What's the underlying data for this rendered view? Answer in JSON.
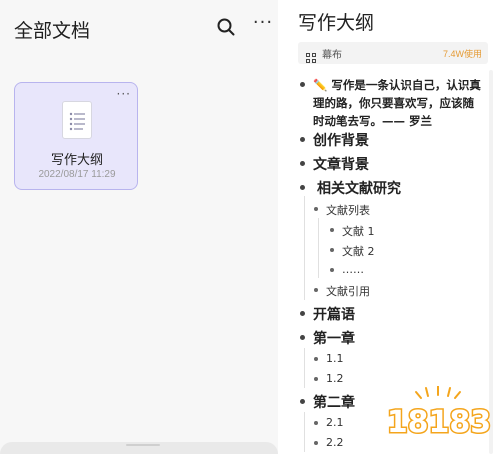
{
  "left": {
    "title": "全部文档",
    "more_glyph": "···",
    "card": {
      "title": "写作大纲",
      "date": "2022/08/17 11:29",
      "more_glyph": "···"
    }
  },
  "right": {
    "title": "写作大纲",
    "app_bar": {
      "name": "幕布",
      "usage": "7.4W使用"
    },
    "intro": "✏️ 写作是一条认识自己，认识真理的路，你只要喜欢写，应该随时动笔去写。—— 罗兰",
    "items": {
      "bg1": "创作背景",
      "bg2": "文章背景",
      "research": "相关文献研究",
      "lit_list": "文献列表",
      "lit1": "文献 1",
      "lit2": "文献 2",
      "lit_more": "……",
      "lit_cite": "文献引用",
      "opening": "开篇语",
      "ch1": "第一章",
      "ch1_1": "1.1",
      "ch1_2": "1.2",
      "ch2": "第二章",
      "ch2_1": "2.1",
      "ch2_2": "2.2"
    }
  },
  "watermark": {
    "text": "18183"
  },
  "colors": {
    "card_bg": "#e8e6fb",
    "card_border": "#b8b4ee",
    "usage": "#e59b35",
    "watermark": "#f4a51c"
  }
}
